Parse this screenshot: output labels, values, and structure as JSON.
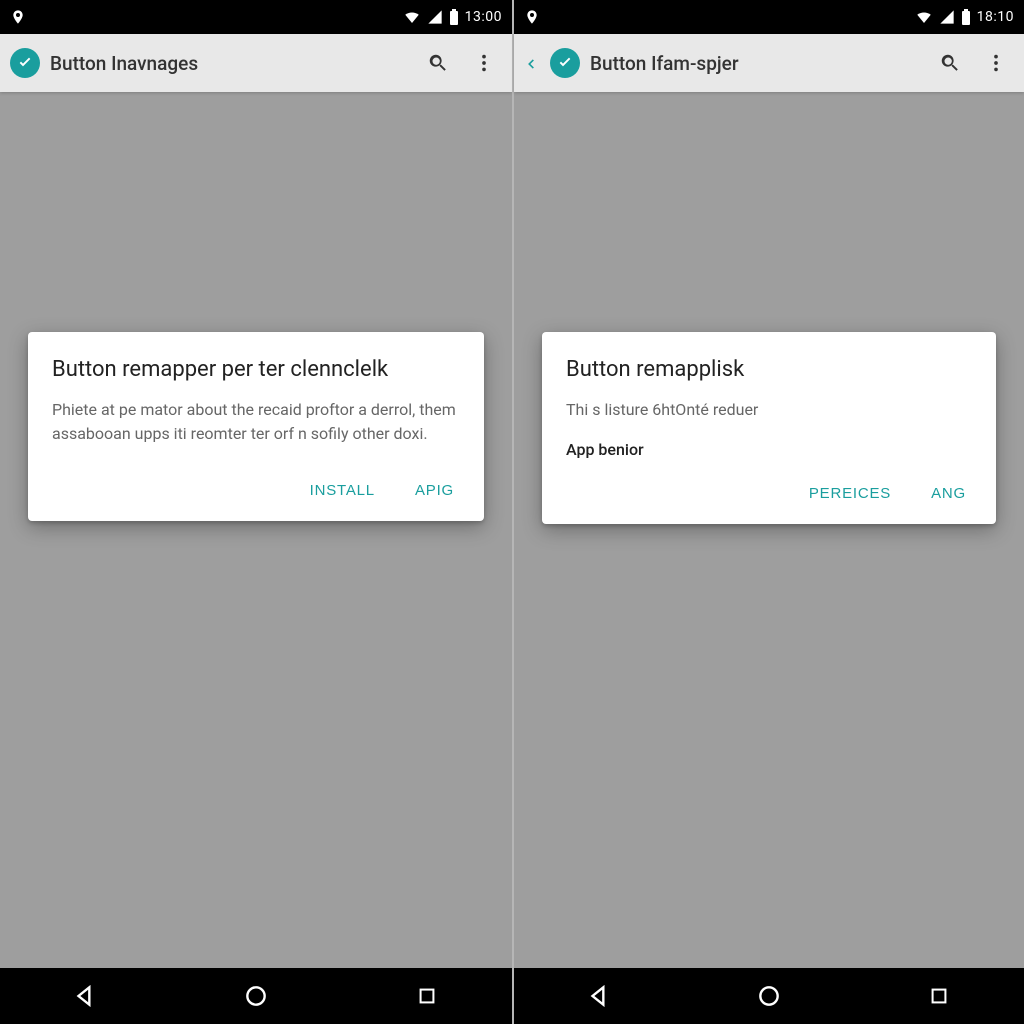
{
  "accent_color": "#1a9e9e",
  "left": {
    "status": {
      "time": "13:00"
    },
    "appbar": {
      "title": "Button Inavnages",
      "has_back": false
    },
    "dialog": {
      "title": "Button remapper per ter clennclelk",
      "body": "Phiete at pe mator about the recaid proftor a derrol, them assabooan upps iti reomter ter orf n sofily other doxi.",
      "actions": {
        "primary": "INSTALL",
        "secondary": "APIG"
      }
    }
  },
  "right": {
    "status": {
      "time": "18:10"
    },
    "appbar": {
      "title": "Button Ifam-spjer",
      "has_back": true
    },
    "dialog": {
      "title": "Button remapplisk",
      "body": "Thi s listure 6htOnté reduer",
      "subhead": "App benior",
      "actions": {
        "primary": "PEREICES",
        "secondary": "ANG"
      }
    }
  }
}
